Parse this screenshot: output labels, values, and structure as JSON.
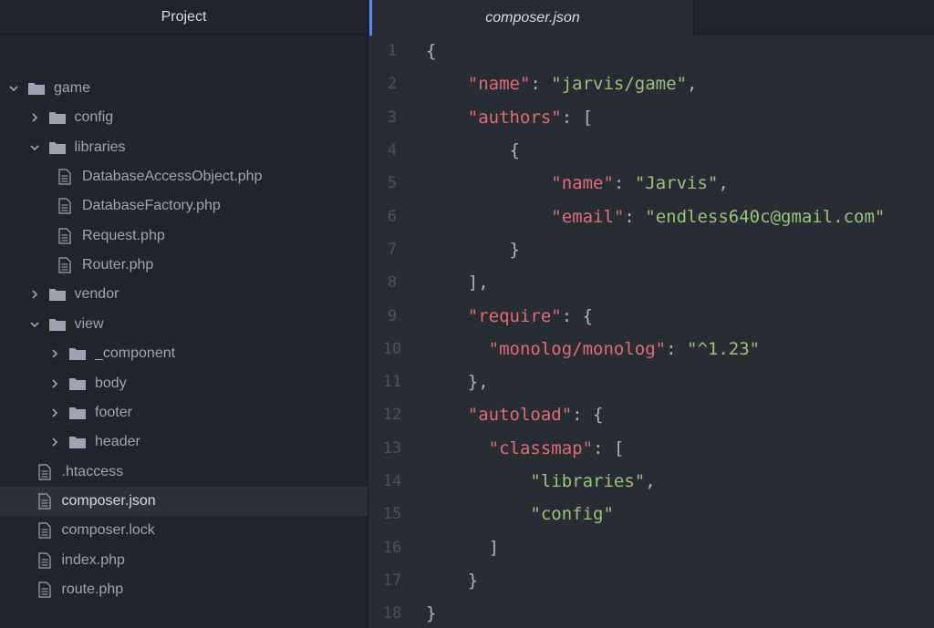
{
  "sidebar": {
    "title": "Project",
    "tree": [
      {
        "label": "game",
        "type": "folder",
        "expanded": true,
        "depth": 0
      },
      {
        "label": "config",
        "type": "folder",
        "expanded": false,
        "depth": 1
      },
      {
        "label": "libraries",
        "type": "folder",
        "expanded": true,
        "depth": 1
      },
      {
        "label": "DatabaseAccessObject.php",
        "type": "file",
        "depth": 2
      },
      {
        "label": "DatabaseFactory.php",
        "type": "file",
        "depth": 2
      },
      {
        "label": "Request.php",
        "type": "file",
        "depth": 2
      },
      {
        "label": "Router.php",
        "type": "file",
        "depth": 2
      },
      {
        "label": "vendor",
        "type": "folder",
        "expanded": false,
        "depth": 1
      },
      {
        "label": "view",
        "type": "folder",
        "expanded": true,
        "depth": 1
      },
      {
        "label": "_component",
        "type": "folder",
        "expanded": false,
        "depth": 2
      },
      {
        "label": "body",
        "type": "folder",
        "expanded": false,
        "depth": 2
      },
      {
        "label": "footer",
        "type": "folder",
        "expanded": false,
        "depth": 2
      },
      {
        "label": "header",
        "type": "folder",
        "expanded": false,
        "depth": 2
      },
      {
        "label": ".htaccess",
        "type": "file",
        "depth": 1
      },
      {
        "label": "composer.json",
        "type": "file",
        "depth": 1,
        "selected": true
      },
      {
        "label": "composer.lock",
        "type": "file",
        "depth": 1
      },
      {
        "label": "index.php",
        "type": "file",
        "depth": 1
      },
      {
        "label": "route.php",
        "type": "file",
        "depth": 1
      }
    ]
  },
  "editor": {
    "tab_title": "composer.json",
    "lines": [
      {
        "num": "1",
        "indent": "",
        "tokens": [
          [
            "p",
            "{"
          ]
        ]
      },
      {
        "num": "2",
        "indent": "    ",
        "tokens": [
          [
            "k",
            "\"name\""
          ],
          [
            "p",
            ": "
          ],
          [
            "s",
            "\"jarvis/game\""
          ],
          [
            "p",
            ","
          ]
        ]
      },
      {
        "num": "3",
        "indent": "    ",
        "tokens": [
          [
            "k",
            "\"authors\""
          ],
          [
            "p",
            ": ["
          ]
        ]
      },
      {
        "num": "4",
        "indent": "        ",
        "tokens": [
          [
            "p",
            "{"
          ]
        ]
      },
      {
        "num": "5",
        "indent": "            ",
        "tokens": [
          [
            "k",
            "\"name\""
          ],
          [
            "p",
            ": "
          ],
          [
            "s",
            "\"Jarvis\""
          ],
          [
            "p",
            ","
          ]
        ]
      },
      {
        "num": "6",
        "indent": "            ",
        "tokens": [
          [
            "k",
            "\"email\""
          ],
          [
            "p",
            ": "
          ],
          [
            "s",
            "\"endless640c@gmail.com\""
          ]
        ]
      },
      {
        "num": "7",
        "indent": "        ",
        "tokens": [
          [
            "p",
            "}"
          ]
        ]
      },
      {
        "num": "8",
        "indent": "    ",
        "tokens": [
          [
            "p",
            "],"
          ]
        ]
      },
      {
        "num": "9",
        "indent": "    ",
        "tokens": [
          [
            "k",
            "\"require\""
          ],
          [
            "p",
            ": {"
          ]
        ]
      },
      {
        "num": "10",
        "indent": "      ",
        "tokens": [
          [
            "k",
            "\"monolog/monolog\""
          ],
          [
            "p",
            ": "
          ],
          [
            "s",
            "\"^1.23\""
          ]
        ]
      },
      {
        "num": "11",
        "indent": "    ",
        "tokens": [
          [
            "p",
            "},"
          ]
        ]
      },
      {
        "num": "12",
        "indent": "    ",
        "tokens": [
          [
            "k",
            "\"autoload\""
          ],
          [
            "p",
            ": {"
          ]
        ]
      },
      {
        "num": "13",
        "indent": "      ",
        "tokens": [
          [
            "k",
            "\"classmap\""
          ],
          [
            "p",
            ": ["
          ]
        ]
      },
      {
        "num": "14",
        "indent": "          ",
        "tokens": [
          [
            "s",
            "\"libraries\""
          ],
          [
            "p",
            ","
          ]
        ]
      },
      {
        "num": "15",
        "indent": "          ",
        "tokens": [
          [
            "s",
            "\"config\""
          ]
        ]
      },
      {
        "num": "16",
        "indent": "      ",
        "tokens": [
          [
            "p",
            "]"
          ]
        ]
      },
      {
        "num": "17",
        "indent": "    ",
        "tokens": [
          [
            "p",
            "}"
          ]
        ]
      },
      {
        "num": "18",
        "indent": "",
        "tokens": [
          [
            "p",
            "}"
          ]
        ]
      }
    ]
  },
  "colors": {
    "sidebar_bg": "#21252b",
    "editor_bg": "#282c34",
    "selected_row": "#2c313a",
    "key": "#e06c75",
    "string": "#98c379",
    "punctuation": "#abb2bf",
    "line_number": "#495162",
    "tab_accent": "#568af2"
  },
  "icons": {
    "folder": "folder-icon",
    "file": "file-text-icon",
    "expanded": "chevron-down-icon",
    "collapsed": "chevron-right-icon"
  }
}
